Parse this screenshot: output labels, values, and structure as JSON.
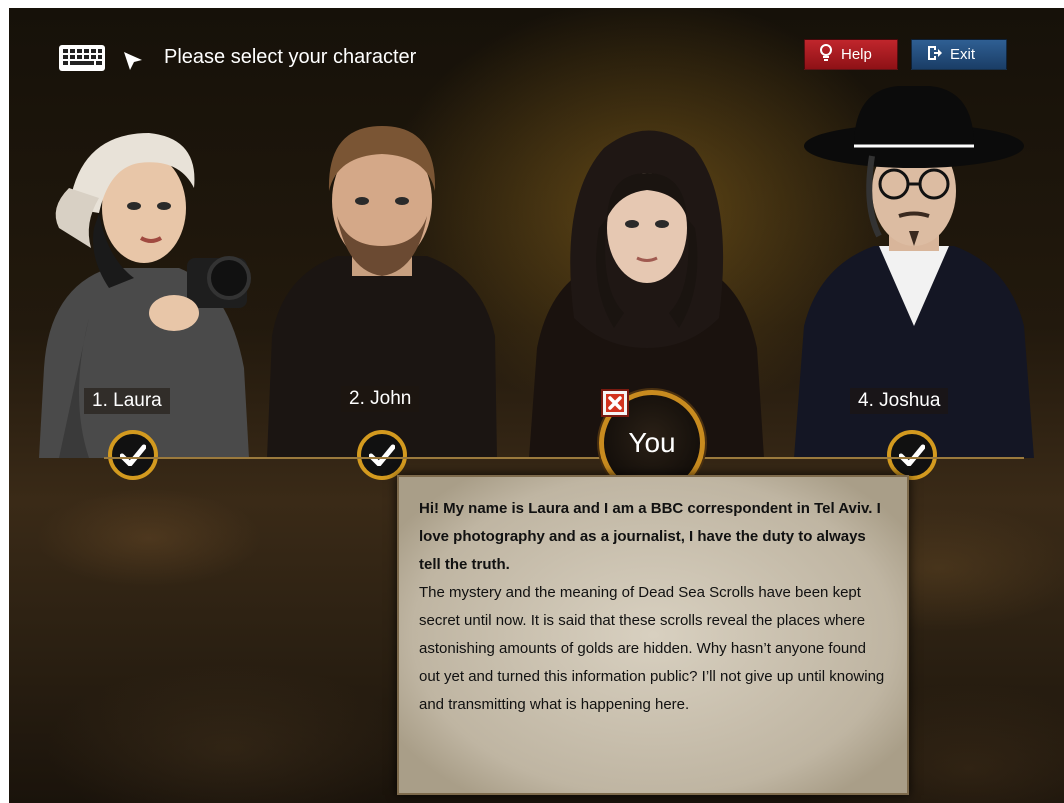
{
  "header": {
    "title": "Please select your character",
    "help_label": "Help",
    "exit_label": "Exit"
  },
  "characters": [
    {
      "name": "1. Laura",
      "state": "available"
    },
    {
      "name": "2. John",
      "state": "available"
    },
    {
      "name": "",
      "state": "selected"
    },
    {
      "name": "4. Joshua",
      "state": "available"
    }
  ],
  "selected": {
    "badge_label": "You"
  },
  "bio": {
    "intro": "Hi! My name is Laura and I am a BBC correspondent in Tel Aviv. I love photography and as a journalist, I have the duty to always tell the truth.",
    "story": "The mystery and the meaning of Dead Sea Scrolls have been kept secret until now. It is said that these scrolls reveal the places where astonishing amounts of golds are hidden. Why hasn’t anyone found out yet and turned this information public? I’ll not give up until knowing and transmitting what is happening here."
  },
  "colors": {
    "help_button": "#b01c22",
    "exit_button": "#244e80",
    "accent_gold": "#d39a1f"
  },
  "icons": [
    "keyboard-icon",
    "cursor-icon",
    "lightbulb-icon",
    "exit-icon",
    "checkmark-icon",
    "close-icon"
  ]
}
